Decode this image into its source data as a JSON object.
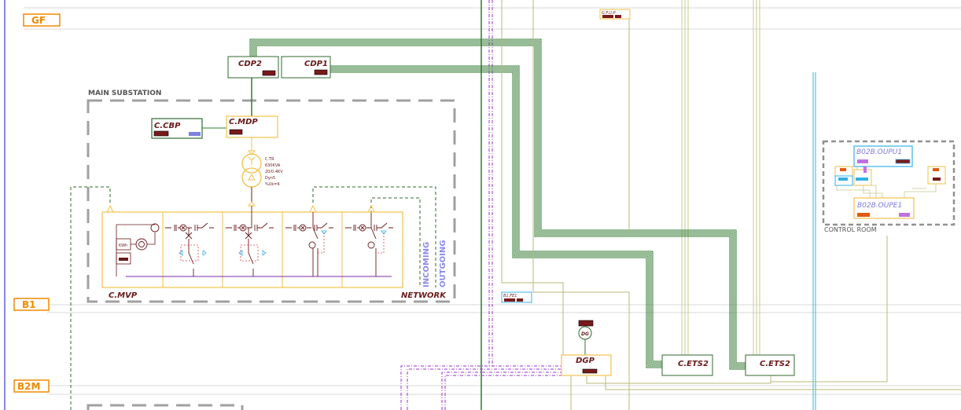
{
  "levels": {
    "gf": "GF",
    "b1": "B1",
    "b2m": "B2M"
  },
  "areas": {
    "main_substation": "MAIN SUBSTATION",
    "control_room": "CONTROL ROOM"
  },
  "panels": {
    "cdp2": "CDP2",
    "cdp1": "CDP1",
    "ccbp": "C.CBP",
    "cmdp": "C.MDP",
    "cmvp": "C.MVP",
    "network": "NETWORK",
    "incoming": "INCOMING",
    "outgoing": "OUTGOING",
    "dgp": "DGP",
    "dg": "DG",
    "cets2_a": "C.ETS2",
    "cets2_b": "C.ETS2",
    "gfup": "G.F.U.P",
    "b1fe1": "B1.FE1",
    "b02b_oupu1": "B02B.OUPU1",
    "b02b_oupe1": "B02B.OUPE1"
  },
  "transformer": {
    "name": "C.TR",
    "rating": "630KVA",
    "voltage": "20/0.4KV",
    "vector": "Dyn5",
    "uk": "%Uk=6"
  },
  "meter": {
    "kwh": "KWh"
  },
  "colors": {
    "level_label": "#f08a00",
    "panel_text": "#6a1a1a",
    "green_cable": "#2f7a2f",
    "olive_cable": "#b8b87a",
    "purple_cable": "#9b30d0",
    "blue_cable": "#35b0e8",
    "panel_border": "#f2c14a",
    "substation_border": "#a0a0a0"
  }
}
